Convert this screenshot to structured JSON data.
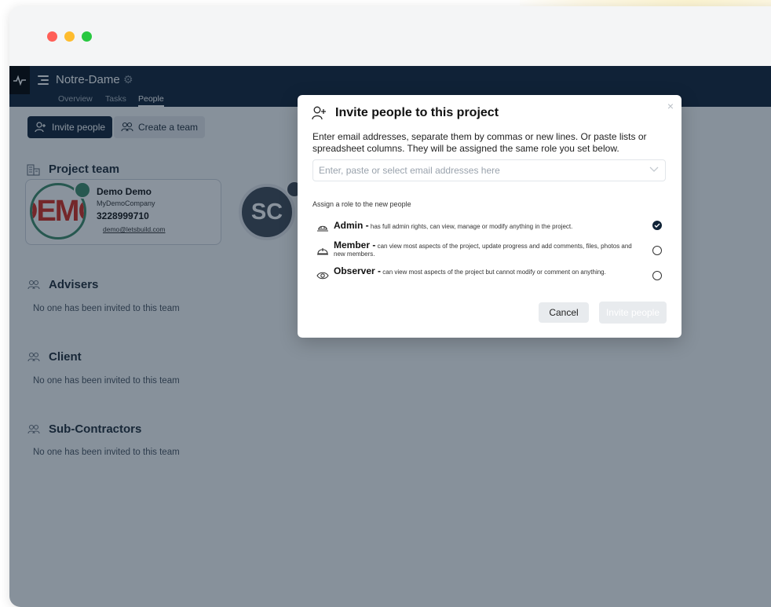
{
  "window": {
    "controls": [
      "close",
      "minimize",
      "maximize"
    ]
  },
  "topnav": {
    "project_name": "Notre-Dame",
    "tabs": [
      {
        "label": "Overview",
        "active": false
      },
      {
        "label": "Tasks",
        "active": false
      },
      {
        "label": "People",
        "active": true
      }
    ]
  },
  "actions": {
    "invite_label": "Invite people",
    "create_team_label": "Create a team"
  },
  "project_team": {
    "title": "Project team",
    "members": [
      {
        "logo_text": "DEMO",
        "name": "Demo Demo",
        "company": "MyDemoCompany",
        "phone": "3228999710",
        "email": "demo@letsbuild.com"
      },
      {
        "initials": "SC"
      }
    ]
  },
  "teams": [
    {
      "title": "Advisers",
      "empty_text": "No one has been invited to this team"
    },
    {
      "title": "Client",
      "empty_text": "No one has been invited to this team"
    },
    {
      "title": "Sub-Contractors",
      "empty_text": "No one has been invited to this team"
    }
  ],
  "modal": {
    "title": "Invite people to this project",
    "close_symbol": "×",
    "description": "Enter email addresses, separate them by commas or new lines. Or paste lists or spreadsheet columns. They will be assigned the same role you set below.",
    "email_placeholder": "Enter, paste or select email addresses here",
    "assign_label": "Assign a role to the new people",
    "roles": [
      {
        "name": "Admin -",
        "description": "has full admin rights, can view, manage or modify anything in the project.",
        "selected": true,
        "icon": "hard-hat-icon"
      },
      {
        "name": "Member -",
        "description": "can view most aspects of the project, update progress and add comments, files, photos and new members.",
        "selected": false,
        "icon": "helmet-icon"
      },
      {
        "name": "Observer -",
        "description": "can view most aspects of the project but cannot modify or comment on anything.",
        "selected": false,
        "icon": "eye-icon"
      }
    ],
    "cancel_label": "Cancel",
    "submit_label": "Invite people"
  },
  "colors": {
    "nav_bg": "#102337",
    "primary_button": "#102337",
    "overlay": "#102337",
    "demo_ring": "#3d8c69",
    "demo_text": "#d52b1e"
  }
}
